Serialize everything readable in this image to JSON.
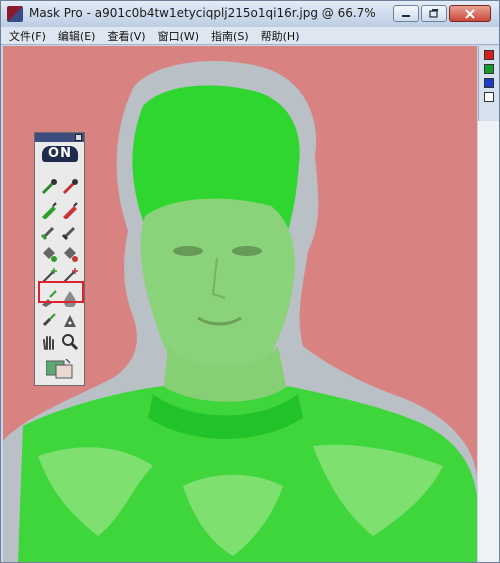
{
  "window": {
    "title": "Mask Pro - a901c0b4tw1etyciqplj215o1qi16r.jpg @ 66.7%"
  },
  "menu": {
    "items": [
      "文件(F)",
      "编辑(E)",
      "查看(V)",
      "窗口(W)",
      "指南(S)",
      "帮助(H)"
    ]
  },
  "toolbox": {
    "logo": "ON",
    "selected_tool": "keep-highlighter"
  },
  "swatches": {
    "colors": [
      "#d81e1e",
      "#129a2a",
      "#1b3cc8"
    ]
  },
  "colors": {
    "canvas_background": "#d88282",
    "keep_mask": "#35d22f",
    "drop_mask": "#b4bec6",
    "highlight_border": "#e0232c"
  },
  "icons": {
    "tools": [
      "keep-eyedropper-icon",
      "drop-eyedropper-icon",
      "keep-highlighter-icon",
      "drop-highlighter-icon",
      "magic-brush-icon",
      "brush-icon",
      "magic-fill-icon",
      "fill-bucket-icon",
      "magic-wand-icon",
      "wand-icon",
      "magic-pen-icon",
      "drop-icon",
      "chisel-icon",
      "pen-icon",
      "hand-icon",
      "zoom-icon"
    ]
  }
}
